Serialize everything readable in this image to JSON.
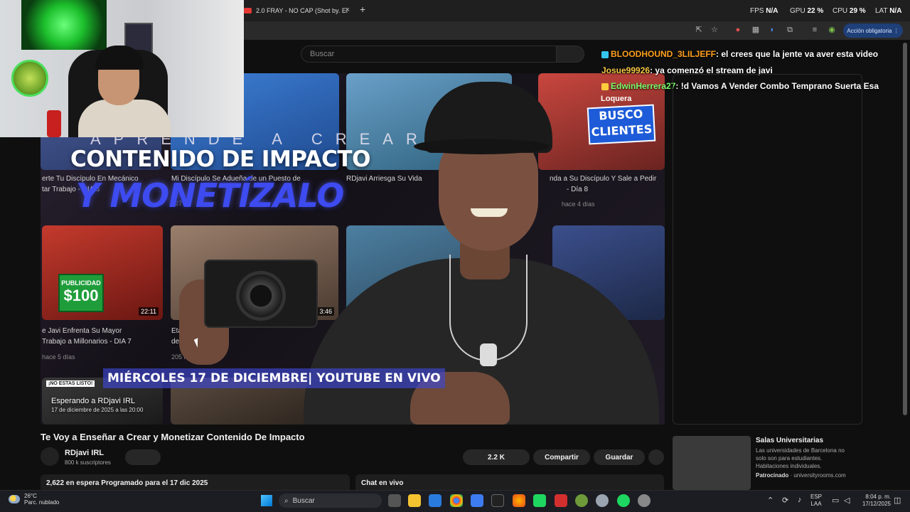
{
  "browser": {
    "tab_title": "2.0 FRAY - NO CAP (Shot by. El",
    "new_tab": "+",
    "close_tab": "×",
    "account_button": "Acción obligatoria",
    "perf": {
      "fps_label": "FPS",
      "fps_value": "N/A",
      "gpu_label": "GPU",
      "gpu_value": "22 %",
      "cpu_label": "CPU",
      "cpu_value": "29 %",
      "lat_label": "LAT",
      "lat_value": "N/A"
    }
  },
  "youtube": {
    "search_placeholder": "Buscar"
  },
  "player": {
    "thumbnail_text": {
      "aprende": "APRENDE A CREAR",
      "contenido": "CONTENIDO DE IMPACTO",
      "monetizalo": "Y MONETÍZALO",
      "banner": "MIÉRCOLES 17 DE DICIEMBRE| YOUTUBE EN VIVO"
    },
    "bg_videos": [
      {
        "title": "erte Tu Discípulo En Mecánico",
        "title2": "tar Trabajo - DIA 8"
      },
      {
        "title": "Mi Discípulo Se Adueña de un Puesto de",
        "title2": "127"
      },
      {
        "title": "RDjavi Arriesga Su Vida",
        "title2": ""
      },
      {
        "title": "nda a Su Discípulo Y Sale a Pedir",
        "title2": "- Día 8",
        "meta": "hace 4 días"
      },
      {
        "title": "e Javi Enfrenta Su Mayor",
        "title2": "Trabajo a Millonarios - DIA 7",
        "meta": "hace 5 días",
        "duration": "22:11"
      },
      {
        "title": "Etan",
        "title2": "defini",
        "meta": "205 k vist",
        "duration": "3:46"
      }
    ],
    "loquera": "Loquera",
    "busco": "BUSCO CLIENTES",
    "publicidad_top": "PUBLICIDAD",
    "publicidad_amount": "$100",
    "listo": "¡NO ESTAS LISTO!",
    "waiting_title": "Esperando a RDjavi IRL",
    "waiting_date": "17 de diciembre de 2025 a las 20:00"
  },
  "chat": [
    {
      "user": "BLOODHOUND_3LILJEFF",
      "message": ": el crees que la jente va aver esta video"
    },
    {
      "user": "Josue99926",
      "message": ": ya comenzó el stream de javi"
    },
    {
      "user": "EdwinHerrera27",
      "message": ": !d Vamos A Vender Combo Temprano Suerta Esa"
    }
  ],
  "video": {
    "title": "Te Voy a Enseñar a Crear y Monetizar Contenido De Impacto",
    "channel": "RDjavi IRL",
    "subscribers": "800 k suscriptores",
    "likes": "2.2 K",
    "share": "Compartir",
    "save": "Guardar",
    "waiting_stats": "2,622 en espera  Programado para el 17 dic 2025",
    "live_chat": "Chat en vivo"
  },
  "ad": {
    "title": "Salas Universitarias",
    "description": "Las universidades de Barcelona no solo son para estudiantes. Habitaciones individuales.",
    "sponsored": "Patrocinado",
    "domain": " · universityrooms.com"
  },
  "taskbar": {
    "temp": "26°C",
    "weather": "Parc. nublado",
    "search": "Buscar",
    "lang1": "ESP",
    "lang2": "LAA",
    "time": "8:04 p. m.",
    "date": "17/12/2025"
  },
  "colors": {
    "accent_blue": "#3d4bf0",
    "yt_red": "#e53935"
  }
}
